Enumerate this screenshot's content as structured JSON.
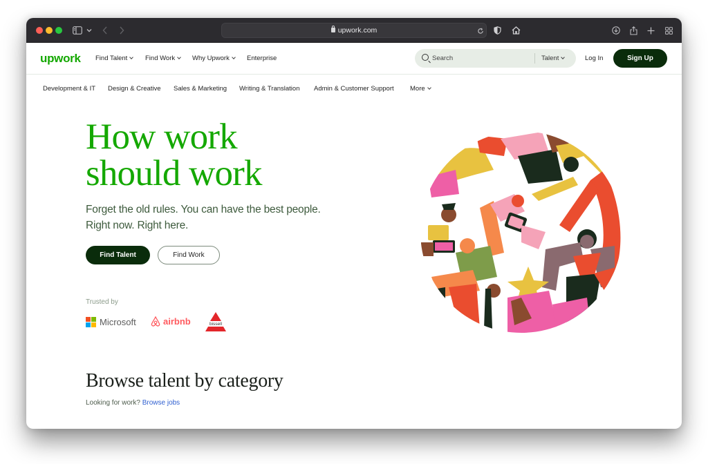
{
  "browser": {
    "url": "upwork.com",
    "window_controls": [
      "close",
      "minimize",
      "maximize"
    ],
    "toolbar_icons": [
      "sidebar-icon",
      "chevron-down-icon",
      "back-icon",
      "forward-icon",
      "reload-icon",
      "shield-icon",
      "home-icon",
      "download-icon",
      "share-icon",
      "new-tab-icon",
      "tab-overview-icon"
    ]
  },
  "nav": {
    "logo": "upwork",
    "items": [
      {
        "label": "Find Talent",
        "dropdown": true
      },
      {
        "label": "Find Work",
        "dropdown": true
      },
      {
        "label": "Why Upwork",
        "dropdown": true
      },
      {
        "label": "Enterprise",
        "dropdown": false
      }
    ],
    "search": {
      "placeholder": "Search",
      "type_selected": "Talent"
    },
    "login_label": "Log In",
    "signup_label": "Sign Up"
  },
  "categories": {
    "items": [
      "Development & IT",
      "Design & Creative",
      "Sales & Marketing",
      "Writing & Translation",
      "Admin & Customer Support"
    ],
    "more_label": "More"
  },
  "hero": {
    "title_line1": "How work",
    "title_line2": "should work",
    "subtitle_line1": "Forget the old rules. You can have the best people.",
    "subtitle_line2": "Right now. Right here.",
    "primary_button": "Find Talent",
    "secondary_button": "Find Work",
    "trusted_label": "Trusted by",
    "trusted_logos": [
      "Microsoft",
      "airbnb",
      "bissell"
    ]
  },
  "browse": {
    "title": "Browse talent by category",
    "prompt": "Looking for work?",
    "link": "Browse jobs"
  },
  "colors": {
    "brand_green": "#14a800",
    "dark_green": "#0a2c0b",
    "link_blue": "#2f5fd0"
  }
}
